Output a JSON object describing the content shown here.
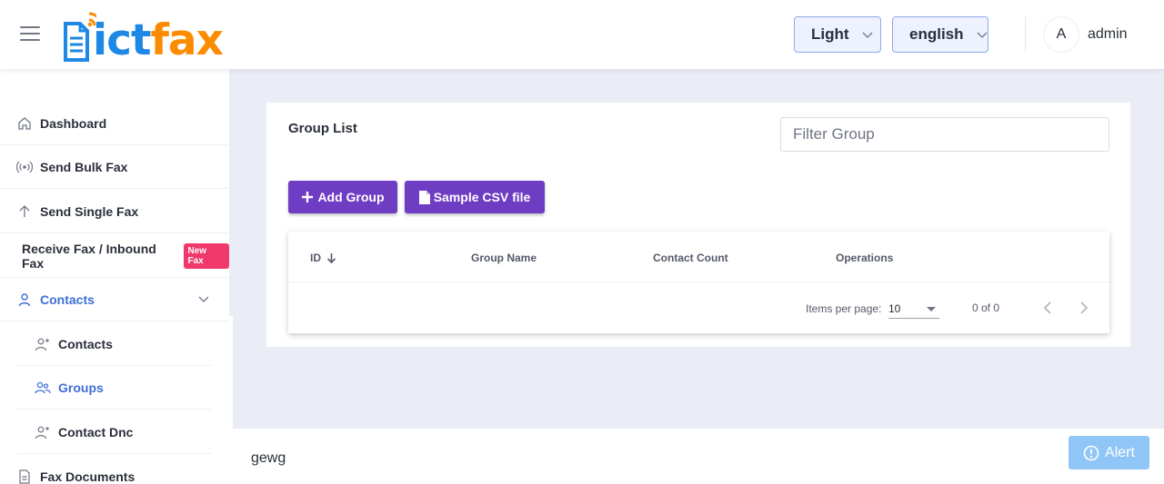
{
  "header": {
    "logo_part1": "ict",
    "logo_part2": "fax",
    "theme_select": "Light",
    "language_select": "english",
    "avatar_initial": "A",
    "username": "admin"
  },
  "sidebar": {
    "items": [
      {
        "label": "Dashboard",
        "icon": "home-icon"
      },
      {
        "label": "Send Bulk Fax",
        "icon": "broadcast-icon"
      },
      {
        "label": "Send Single Fax",
        "icon": "arrow-up-icon"
      },
      {
        "label": "Receive Fax / Inbound Fax",
        "badge": "New Fax"
      },
      {
        "label": "Contacts",
        "icon": "user-icon",
        "expanded": true
      },
      {
        "label": "Contacts",
        "icon": "user-add-icon"
      },
      {
        "label": "Groups",
        "icon": "users-icon",
        "active": true
      },
      {
        "label": "Contact Dnc",
        "icon": "user-add-icon"
      },
      {
        "label": "Fax Documents",
        "icon": "document-icon"
      }
    ]
  },
  "main": {
    "title": "Group List",
    "filter_placeholder": "Filter Group",
    "add_button": "Add Group",
    "csv_button": "Sample CSV file",
    "table": {
      "columns": [
        "ID",
        "Group Name",
        "Contact Count",
        "Operations"
      ],
      "rows": []
    },
    "paginator": {
      "items_per_page_label": "Items per page:",
      "page_size": "10",
      "range": "0 of 0"
    }
  },
  "footer": {
    "text": "gewg",
    "alert_button": "Alert"
  },
  "colors": {
    "primary": "#6f3cc4",
    "active_nav": "#3d6fd8",
    "badge": "#f0386b",
    "logo_blue": "#1e88e5",
    "logo_orange": "#fb8c00",
    "alert": "#90c6f7"
  }
}
